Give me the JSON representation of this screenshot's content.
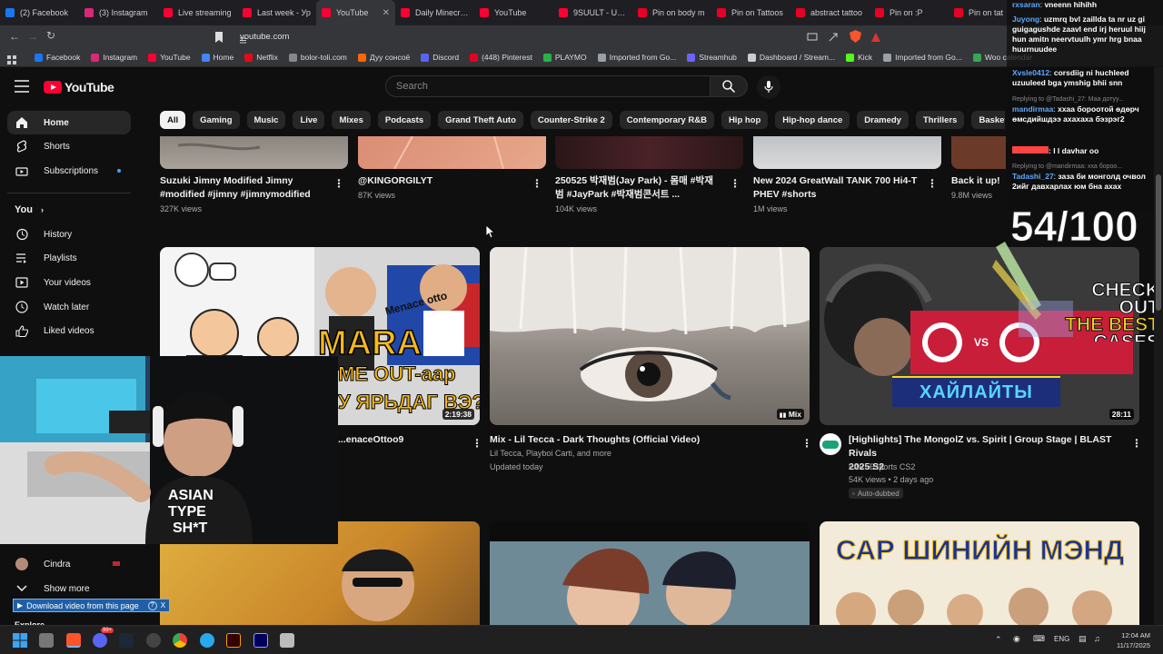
{
  "tabs": [
    {
      "label": "(2) Facebook",
      "color": "#1877f2"
    },
    {
      "label": "(3) Instagram",
      "color": "#d62976"
    },
    {
      "label": "Live streaming",
      "color": "#ff0033"
    },
    {
      "label": "Last week - Ур",
      "color": "#ff0033"
    },
    {
      "label": "YouTube",
      "color": "#ff0033",
      "active": true
    },
    {
      "label": "Daily Minecraft",
      "color": "#ff0033"
    },
    {
      "label": "YouTube",
      "color": "#ff0033"
    },
    {
      "label": "9SUULT - UNU",
      "color": "#ff0033"
    },
    {
      "label": "Pin on body m",
      "color": "#e60023"
    },
    {
      "label": "Pin on Tattoos",
      "color": "#e60023"
    },
    {
      "label": "abstract tattoo",
      "color": "#e60023"
    },
    {
      "label": "Pin on :P",
      "color": "#e60023"
    },
    {
      "label": "Pin on tat",
      "color": "#e60023"
    }
  ],
  "address": {
    "url": "youtube.com"
  },
  "bookmarks": [
    {
      "label": "Facebook",
      "color": "#1877f2"
    },
    {
      "label": "Instagram",
      "color": "#d62976"
    },
    {
      "label": "YouTube",
      "color": "#ff0033"
    },
    {
      "label": "Home",
      "color": "#4285f4"
    },
    {
      "label": "Netflix",
      "color": "#e50914"
    },
    {
      "label": "bolor-toli.com",
      "color": "#888888"
    },
    {
      "label": "Дуу сонсоё",
      "color": "#ff6600"
    },
    {
      "label": "Discord",
      "color": "#5865f2"
    },
    {
      "label": "(448) Pinterest",
      "color": "#e60023"
    },
    {
      "label": "PLAYMO",
      "color": "#29b24a"
    },
    {
      "label": "Imported from Go...",
      "color": "#9aa0a6"
    },
    {
      "label": "Streamhub",
      "color": "#6c63ff"
    },
    {
      "label": "Dashboard / Stream...",
      "color": "#cccccc"
    },
    {
      "label": "Kick",
      "color": "#53fc18"
    },
    {
      "label": "Imported from Go...",
      "color": "#9aa0a6"
    },
    {
      "label": "Woo calendar",
      "color": "#34a853"
    }
  ],
  "header": {
    "logo_text": "YouTube",
    "search_placeholder": "Search"
  },
  "chips": [
    "All",
    "Gaming",
    "Music",
    "Live",
    "Mixes",
    "Podcasts",
    "Grand Theft Auto",
    "Counter-Strike 2",
    "Contemporary R&B",
    "Hip hop",
    "Hip-hop dance",
    "Dramedy",
    "Thrillers",
    "Basketball",
    "Action"
  ],
  "sidebar": {
    "main": [
      {
        "label": "Home",
        "icon": "home-icon"
      },
      {
        "label": "Shorts",
        "icon": "shorts-icon"
      },
      {
        "label": "Subscriptions",
        "icon": "subscriptions-icon"
      }
    ],
    "you_label": "You",
    "you_items": [
      {
        "label": "History",
        "icon": "history-icon"
      },
      {
        "label": "Playlists",
        "icon": "playlists-icon"
      },
      {
        "label": "Your videos",
        "icon": "your-videos-icon"
      },
      {
        "label": "Watch later",
        "icon": "watch-later-icon"
      },
      {
        "label": "Liked videos",
        "icon": "liked-videos-icon"
      }
    ],
    "sub_channel": "Cindra",
    "show_more": "Show more",
    "explore": "Explore"
  },
  "videos_top": [
    {
      "title1": "Suzuki Jimny  Modified Jimny",
      "title2": "#modified #jimny #jimnymodified",
      "views": "327K views"
    },
    {
      "title1": "@KINGORGILYT",
      "title2": "",
      "views": "87K views"
    },
    {
      "title1": "250525 박재범(Jay Park) - 몸매 #박재",
      "title2": "범 #JayPark #박재범콘서트 ...",
      "views": "104K views"
    },
    {
      "title1": "New 2024 GreatWall TANK 700 Hi4-T",
      "title2": "PHEV #shorts",
      "views": "1M views"
    },
    {
      "title1": "Back it up!",
      "title2": "",
      "views": "9.8M views"
    }
  ],
  "videos_mid": [
    {
      "title": "...enaceOttoo9",
      "channel": "",
      "meta": "",
      "duration": "2:19:38",
      "thumb_lines": [
        "Menace otto",
        "MARA",
        "ME OUT-aap",
        "У ЯРЬДАГ ВЭ?"
      ]
    },
    {
      "title": "Mix - Lil Tecca - Dark Thoughts (Official Video)",
      "channel": "Lil Tecca, Playboi Carti, and more",
      "meta": "Updated today",
      "badge": "Mix"
    },
    {
      "title1": "[Highlights] The MongolZ vs. Spirit | Group Stage | BLAST Rivals",
      "title2": "2025 S2",
      "channel": "PARI Esports CS2",
      "meta": "54K views • 2 days ago",
      "tag": "Auto-dubbed",
      "duration": "28:11",
      "thumb_text": "ХАЙЛАЙТЫ",
      "vs": "VS"
    }
  ],
  "videos_bottom": [
    {
      "thumb_text": "САР ШИНИЙН МЭНД"
    }
  ],
  "chat": {
    "messages": [
      {
        "user": "rxsaran",
        "text": "vneenn hihihh",
        "color": "#5ea9ff"
      },
      {
        "user": "Juyong",
        "text": "uzmrq bvl zaillda ta nr uz gi guigagushde zaavl end irj heruul hiij hun amitn neervtuulh ymr hrg bnaa huurnuudee",
        "color": "#5ea9ff"
      },
      {
        "user": "Xvsle0412",
        "text": "corsdiig ni huchleed uzuuleed bga ymshig bhii snn",
        "color": "#5ea9ff"
      },
      {
        "reply": "Replying to @Tadashi_27: Маа дотуу...",
        "user": "mandirmaa",
        "text": "ххаа бороотой өдөрч өмсдийшдээ ахахаха бэзрэг2",
        "color": "#5ea9ff"
      },
      {
        "user": "",
        "text": ": I l davhar oo",
        "color": "#ff4444"
      },
      {
        "reply": "Replying to @mandirmaa: хха бороо...",
        "user": "Tadashi_27",
        "text": "заза би монголд очвол 2ийг давхарлах юм бна ахах",
        "color": "#5ea9ff"
      }
    ],
    "counter": "54/100",
    "promo": [
      "CHECK OUT",
      "THE BEST",
      "CASES"
    ]
  },
  "download_bar": {
    "label": "Download video from this page",
    "q": "?",
    "x": "X"
  },
  "cursor": "pointer",
  "taskbar": {
    "lang": "ENG",
    "time": "12:04 AM",
    "date": "11/17/2025",
    "badge": "99+"
  }
}
